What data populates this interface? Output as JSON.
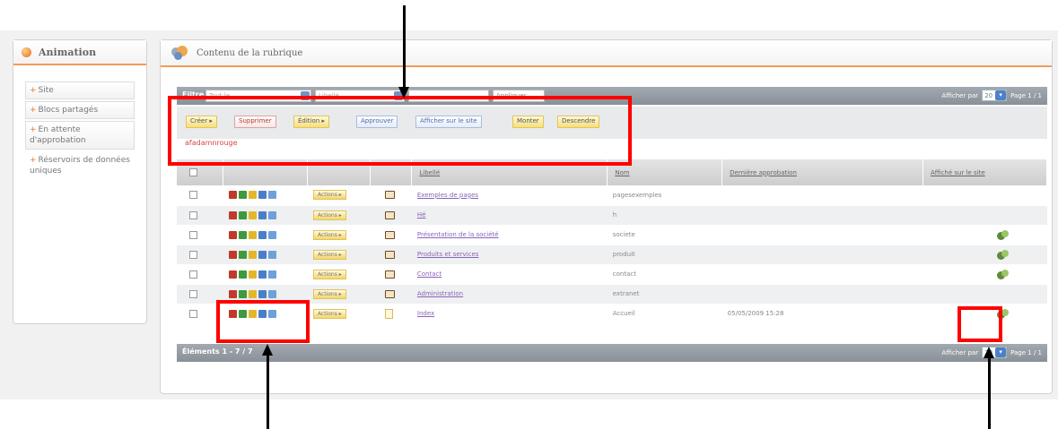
{
  "sidebar": {
    "title": "Animation",
    "items": [
      {
        "label": "Site",
        "bullet": "+",
        "boxed": true
      },
      {
        "label": "Blocs partagés",
        "bullet": "+",
        "boxed": true
      },
      {
        "label": "En attente d'approbation",
        "bullet": "+",
        "boxed": true
      },
      {
        "label": "Réservoirs de données uniques",
        "bullet": "+",
        "boxed": false
      }
    ]
  },
  "main": {
    "title": "Contenu de la rubrique",
    "toolbar": {
      "filter_label": "Filtre",
      "filter1": "Tout le",
      "filter2": "Libellé",
      "filter3": "",
      "filter_button": "Appliquer",
      "per_page_label": "Afficher par",
      "per_page_value": "20",
      "page_info": "Page 1 / 1"
    },
    "actions": [
      "Créer ▸",
      "Supprimer",
      "Édition ▸",
      "Approuver",
      "Afficher sur le site",
      "Monter",
      "Descendre"
    ],
    "warning_text": "afadamnrouge",
    "columns": [
      "",
      "",
      "",
      "",
      "Libellé",
      "Nom",
      "Dernière approbation",
      "Affiché sur le site"
    ],
    "action_button_label": "Actions ▸",
    "rows": [
      {
        "label": "Exemples de pages",
        "name": "pagesexemples",
        "approval": "",
        "on_site": false,
        "type": "folder"
      },
      {
        "label": "Hé",
        "name": "h",
        "approval": "",
        "on_site": false,
        "type": "folder"
      },
      {
        "label": "Présentation de la société",
        "name": "societe",
        "approval": "",
        "on_site": true,
        "type": "folder"
      },
      {
        "label": "Produits et services",
        "name": "produit",
        "approval": "",
        "on_site": true,
        "type": "folder"
      },
      {
        "label": "Contact",
        "name": "contact",
        "approval": "",
        "on_site": true,
        "type": "folder"
      },
      {
        "label": "Administration",
        "name": "extranet",
        "approval": "",
        "on_site": false,
        "type": "folder"
      },
      {
        "label": "Index",
        "name": "Accueil",
        "approval": "05/05/2009 15:28",
        "on_site": true,
        "type": "page"
      }
    ],
    "footer": {
      "elements": "Éléments 1 - 7 / 7",
      "per_page_label": "Afficher par",
      "per_page_value": "20",
      "page_info": "Page 1 / 1"
    }
  },
  "colors": {
    "accent": "#f29a5b",
    "highlight": "#ff0000",
    "grid_header": "#8a9097"
  }
}
